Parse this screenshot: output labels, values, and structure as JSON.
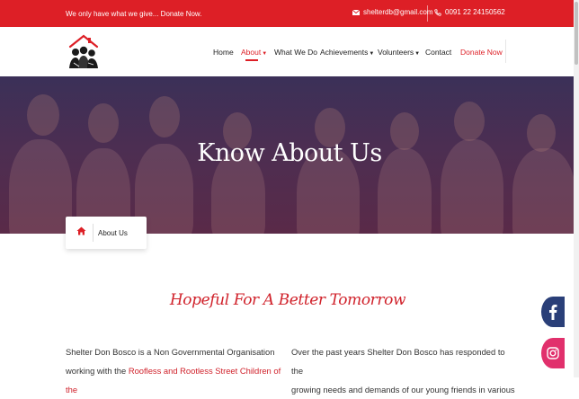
{
  "topbar": {
    "message": "We only have what we give... Donate Now.",
    "email": "shelterdb@gmail.com",
    "phone": "0091 22 24150562"
  },
  "nav": {
    "items": [
      {
        "label": "Home"
      },
      {
        "label": "About"
      },
      {
        "label": "What We Do"
      },
      {
        "label": "Achievements"
      },
      {
        "label": "Volunteers"
      },
      {
        "label": "Contact"
      },
      {
        "label": "Donate Now"
      }
    ]
  },
  "hero": {
    "title": "Know About Us"
  },
  "breadcrumb": {
    "current": "About Us"
  },
  "section": {
    "heading": "Hopeful For A Better Tomorrow",
    "left": {
      "line1": "Shelter Don Bosco is a Non Governmental Organisation",
      "line2_prefix": "working with the ",
      "line2_highlight": "Roofless and Rootless Street Children of the"
    },
    "right": {
      "line1": "Over the past years Shelter Don Bosco has responded to the",
      "line2": "growing needs and demands of our young friends in various"
    }
  },
  "colors": {
    "brand_red": "#dd1f26",
    "facebook": "#2a3f78",
    "instagram": "#e1306c"
  },
  "icons": [
    "envelope-icon",
    "phone-icon",
    "home-icon",
    "facebook-icon",
    "instagram-icon"
  ]
}
